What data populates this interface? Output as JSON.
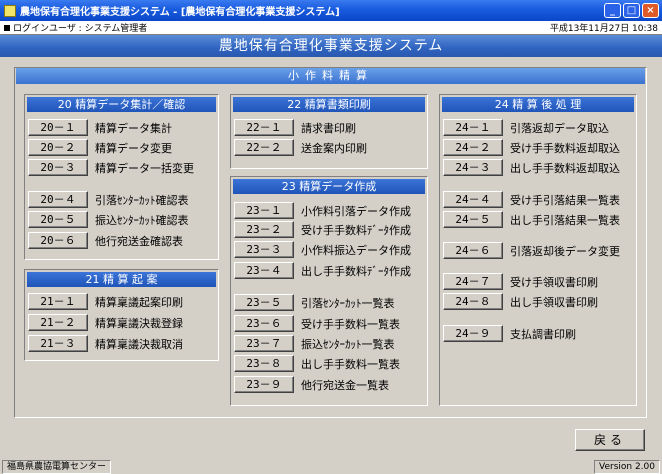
{
  "window": {
    "title": "農地保有合理化事業支援システム - [農地保有合理化事業支援システム]",
    "min": "_",
    "max": "□",
    "close": "×"
  },
  "info": {
    "user_label": "ログインユーザ : システム管理者",
    "date": "平成13年11月27日 10:38"
  },
  "banner": "農地保有合理化事業支援システム",
  "section": "小作料精算",
  "panels": {
    "p20": {
      "title": "20 精算データ集計／確認",
      "items": [
        {
          "code": "20－１",
          "label": "精算データ集計"
        },
        {
          "code": "20－２",
          "label": "精算データ変更"
        },
        {
          "code": "20－３",
          "label": "精算データ一括変更"
        },
        {
          "code": "20－４",
          "label": "引落ｾﾝﾀｰｶｯﾄ確認表"
        },
        {
          "code": "20－５",
          "label": "振込ｾﾝﾀｰｶｯﾄ確認表"
        },
        {
          "code": "20－６",
          "label": "他行宛送金確認表"
        }
      ]
    },
    "p21": {
      "title": "21 精 算 起 案",
      "items": [
        {
          "code": "21－１",
          "label": "精算稟議起案印刷"
        },
        {
          "code": "21－２",
          "label": "精算稟議決裁登録"
        },
        {
          "code": "21－３",
          "label": "精算稟議決裁取消"
        }
      ]
    },
    "p22": {
      "title": "22 精算書類印刷",
      "items": [
        {
          "code": "22－１",
          "label": "請求書印刷"
        },
        {
          "code": "22－２",
          "label": "送金案内印刷"
        }
      ]
    },
    "p23": {
      "title": "23 精算データ作成",
      "items": [
        {
          "code": "23－１",
          "label": "小作料引落データ作成"
        },
        {
          "code": "23－２",
          "label": "受け手手数料ﾃﾞｰﾀ作成"
        },
        {
          "code": "23－３",
          "label": "小作料振込データ作成"
        },
        {
          "code": "23－４",
          "label": "出し手手数料ﾃﾞｰﾀ作成"
        },
        {
          "code": "23－５",
          "label": "引落ｾﾝﾀｰｶｯﾄ一覧表"
        },
        {
          "code": "23－６",
          "label": "受け手手数料一覧表"
        },
        {
          "code": "23－７",
          "label": "振込ｾﾝﾀｰｶｯﾄ一覧表"
        },
        {
          "code": "23－８",
          "label": "出し手手数料一覧表"
        },
        {
          "code": "23－９",
          "label": "他行宛送金一覧表"
        }
      ]
    },
    "p24": {
      "title": "24 精 算 後 処 理",
      "items": [
        {
          "code": "24－１",
          "label": "引落返却データ取込"
        },
        {
          "code": "24－２",
          "label": "受け手手数料返却取込"
        },
        {
          "code": "24－３",
          "label": "出し手手数料返却取込"
        },
        {
          "code": "24－４",
          "label": "受け手引落結果一覧表"
        },
        {
          "code": "24－５",
          "label": "出し手引落結果一覧表"
        },
        {
          "code": "24－６",
          "label": "引落返却後データ変更"
        },
        {
          "code": "24－７",
          "label": "受け手領収書印刷"
        },
        {
          "code": "24－８",
          "label": "出し手領収書印刷"
        },
        {
          "code": "24－９",
          "label": "支払調書印刷"
        }
      ]
    }
  },
  "back_label": "戻る",
  "status": {
    "org": "福島県農協電算センター",
    "version": "Version 2.00"
  }
}
